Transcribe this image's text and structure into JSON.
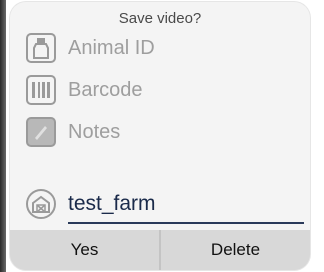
{
  "dialog": {
    "title": "Save video?",
    "fields": [
      {
        "label": "Animal ID",
        "icon": "bottle-icon"
      },
      {
        "label": "Barcode",
        "icon": "barcode-icon"
      },
      {
        "label": "Notes",
        "icon": "notes-icon"
      }
    ],
    "farm": {
      "value": "test_farm",
      "icon": "barn-icon"
    },
    "buttons": {
      "yes": "Yes",
      "delete": "Delete"
    }
  },
  "colors": {
    "dialog_bg": "#f4f4f4",
    "button_bg": "#d8d8d8",
    "underline": "#2a3a5a"
  }
}
